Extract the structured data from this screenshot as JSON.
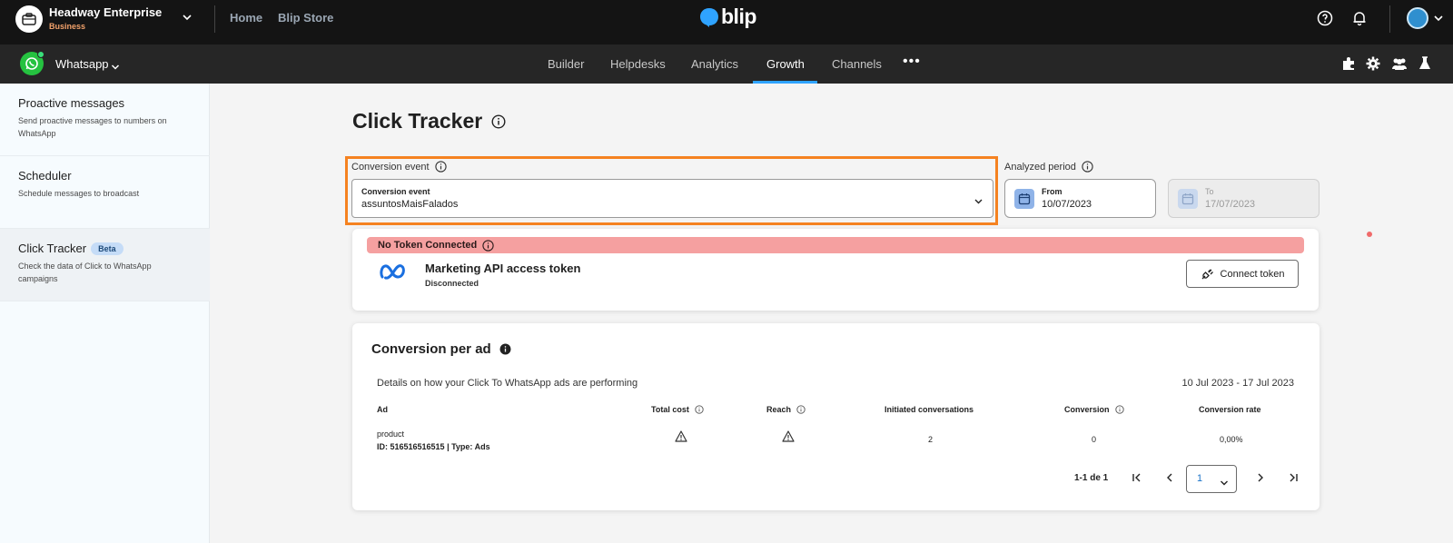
{
  "topbar": {
    "org_name": "Headway Enterprise",
    "org_plan": "Business",
    "links": [
      "Home",
      "Blip Store"
    ],
    "logo_text": "blip"
  },
  "subnav": {
    "channel": "Whatsapp",
    "tabs": [
      "Builder",
      "Helpdesks",
      "Analytics",
      "Growth",
      "Channels"
    ],
    "active_tab": "Growth",
    "more": "•••"
  },
  "sidebar": {
    "items": [
      {
        "title": "Proactive messages",
        "desc": "Send proactive messages to numbers on WhatsApp"
      },
      {
        "title": "Scheduler",
        "desc": "Schedule messages to broadcast"
      },
      {
        "title": "Click Tracker",
        "badge": "Beta",
        "desc": "Check the data of Click to WhatsApp campaigns"
      }
    ]
  },
  "main": {
    "title": "Click Tracker",
    "conversion": {
      "label": "Conversion event",
      "select_label": "Conversion event",
      "select_value": "assuntosMaisFalados"
    },
    "period": {
      "label": "Analyzed period",
      "from_label": "From",
      "from_value": "10/07/2023",
      "to_label": "To",
      "to_value": "17/07/2023"
    },
    "token": {
      "banner": "No Token Connected",
      "title": "Marketing API access token",
      "status": "Disconnected",
      "button": "Connect token"
    },
    "conversion_per_ad": {
      "title": "Conversion per ad",
      "description": "Details on how your Click To WhatsApp ads are performing",
      "range": "10 Jul 2023 - 17 Jul 2023",
      "columns": [
        "Ad",
        "Total cost",
        "Reach",
        "Initiated conversations",
        "Conversion",
        "Conversion rate"
      ],
      "row": {
        "ad_name": "product",
        "ad_id": "ID: 516516516515 | Type: Ads",
        "initiated": "2",
        "conversion": "0",
        "rate": "0,00%"
      },
      "pagination": {
        "summary": "1-1 de 1",
        "page": "1"
      }
    }
  },
  "colors": {
    "topbar": "#141414",
    "subnav": "#262626",
    "accent": "#2fa3ff",
    "highlight": "#f58220",
    "banner": "#f5a0a0"
  }
}
